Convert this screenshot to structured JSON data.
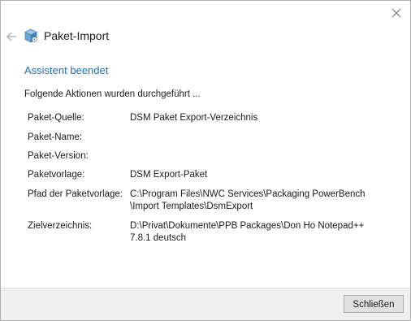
{
  "window": {
    "title": "Paket-Import"
  },
  "main": {
    "heading": "Assistent beendet",
    "intro": "Folgende Aktionen wurden durchgeführt ...",
    "rows": [
      {
        "label": "Paket-Quelle:",
        "value": "DSM Paket Export-Verzeichnis"
      },
      {
        "label": "Paket-Name:",
        "value": ""
      },
      {
        "label": "Paket-Version:",
        "value": ""
      },
      {
        "label": "Paketvorlage:",
        "value": "DSM Export-Paket"
      },
      {
        "label": "Pfad der Paketvorlage:",
        "value": "C:\\Program Files\\NWC Services\\Packaging PowerBench\n\\Import Templates\\DsmExport"
      },
      {
        "label": "Zielverzeichnis:",
        "value": "D:\\Privat\\Dokumente\\PPB Packages\\Don Ho Notepad++\n7.8.1 deutsch"
      }
    ]
  },
  "footer": {
    "close_label": "Schließen"
  },
  "colors": {
    "accent": "#1f6fb8"
  },
  "icons": {
    "back": "arrow-left-icon",
    "package": "package-icon",
    "close": "close-icon"
  }
}
